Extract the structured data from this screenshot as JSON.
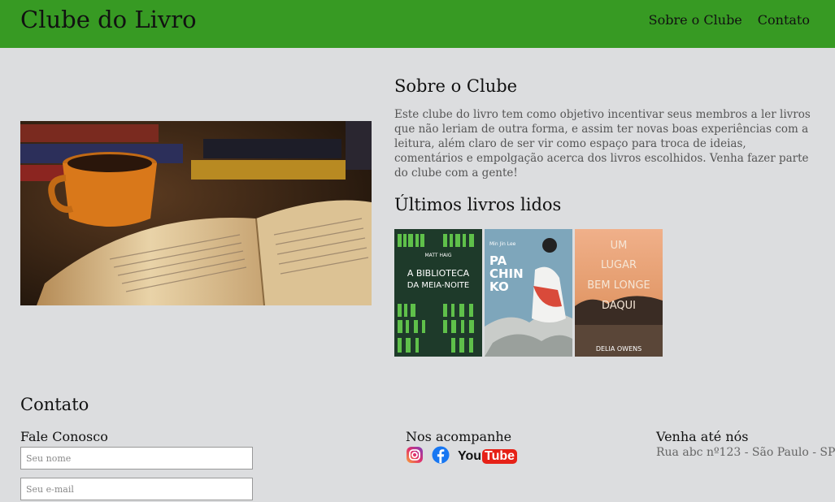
{
  "header": {
    "brand": "Clube do Livro",
    "nav": [
      "Sobre o Clube",
      "Contato"
    ]
  },
  "about": {
    "title": "Sobre o Clube",
    "text": "Este clube do livro tem como objetivo incentivar seus membros a ler livros que não leriam de outra forma, e assim ter novas boas experiências com a leitura, além claro de ser vir como espaço para troca de ideias, comentários e empolgação acerca dos livros escolhidos. Venha fazer parte do clube com a gente!"
  },
  "books": {
    "title": "Últimos livros lidos",
    "items": [
      {
        "author": "MATT HAIG",
        "title_line1": "A BIBLIOTECA",
        "title_line2": "DA MEIA-NOITE"
      },
      {
        "author": "Min Jin Lee",
        "title_line1": "PA",
        "title_line2": "CHIN",
        "title_line3": "KO"
      },
      {
        "title_line1": "UM",
        "title_line2": "LUGAR",
        "title_line3": "BEM LONGE",
        "title_line4": "DAQUI",
        "author": "DELIA OWENS"
      }
    ]
  },
  "contact": {
    "title": "Contato",
    "form_title": "Fale Conosco",
    "name_placeholder": "Seu nome",
    "email_placeholder": "Seu e-mail",
    "social_title": "Nos acompanhe",
    "social_icons": [
      "instagram-icon",
      "facebook-icon",
      "youtube-icon"
    ],
    "youtube_text": "You",
    "youtube_tube": "Tube",
    "visit_title": "Venha até nós",
    "address": "Rua abc nº123 - São Paulo - SP"
  },
  "colors": {
    "header_bg": "#379a23",
    "page_bg": "#dcdddf"
  }
}
